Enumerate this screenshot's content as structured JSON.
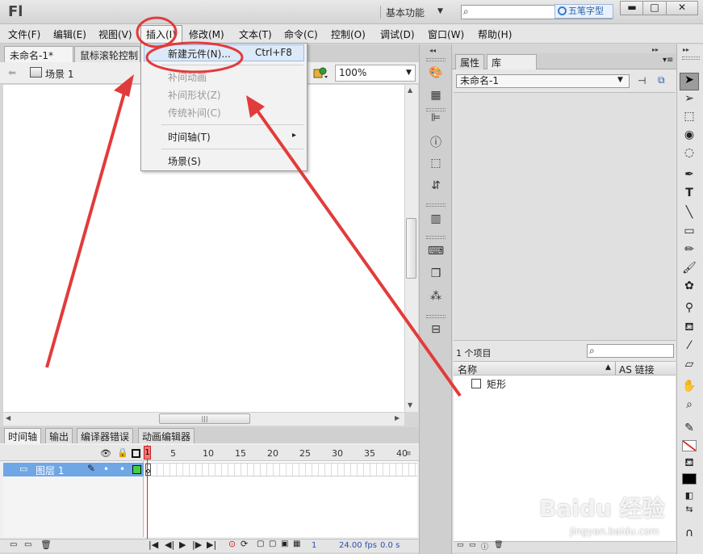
{
  "title_bar": {
    "app_logo": "Fl",
    "workspace": "基本功能",
    "search_placeholder": "",
    "watermark_badge": "五笔字型",
    "min_button": "▬",
    "restore_button": "□",
    "close_button": "✕"
  },
  "menu": {
    "items": [
      "文件(F)",
      "编辑(E)",
      "视图(V)",
      "插入(I)",
      "修改(M)",
      "文本(T)",
      "命令(C)",
      "控制(O)",
      "调试(D)",
      "窗口(W)",
      "帮助(H)"
    ]
  },
  "insert_menu": {
    "items": [
      {
        "label": "新建元件(N)...",
        "shortcut": "Ctrl+F8",
        "enabled": true
      },
      {
        "label": "补间动画",
        "enabled": false
      },
      {
        "label": "补间形状(Z)",
        "enabled": false
      },
      {
        "label": "传统补间(C)",
        "enabled": false
      },
      {
        "label": "时间轴(T)",
        "enabled": true,
        "submenu": "▸"
      },
      {
        "label": "场景(S)",
        "enabled": true
      }
    ]
  },
  "doc_tabs": [
    "未命名-1*",
    "鼠标滚轮控制"
  ],
  "edit_bar": {
    "scene": "场景 1",
    "zoom": "100%"
  },
  "timeline": {
    "tabs": [
      "时间轴",
      "输出",
      "编译器错误",
      "动画编辑器"
    ],
    "frame_numbers": [
      "1",
      "5",
      "10",
      "15",
      "20",
      "25",
      "30",
      "35",
      "40"
    ],
    "layer_name": "图层 1",
    "current_frame": "1",
    "fps": "24.00",
    "fps_unit": "fps",
    "time": "0.0 s"
  },
  "right_panel": {
    "tabs": [
      "属性",
      "库"
    ],
    "library_doc": "未命名-1",
    "item_count": "1 个项目",
    "col_name": "名称",
    "col_linkage": "AS 链接",
    "items": [
      "矩形"
    ]
  },
  "footer": {
    "baidu": "Baidu 经验",
    "url": "jingyan.baidu.com"
  },
  "colors": {
    "annotation_red": "#e23b3b",
    "layer_highlight": "#6ea6e6",
    "playhead": "#e02020"
  }
}
